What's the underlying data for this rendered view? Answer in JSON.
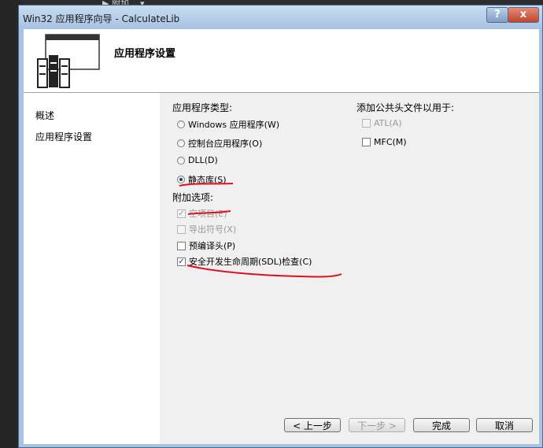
{
  "ide": {
    "run_label": "▶ 附加... ▾"
  },
  "window": {
    "title": "Win32 应用程序向导 - CalculateLib",
    "help_label": "?",
    "close_label": "x"
  },
  "header": {
    "title": "应用程序设置"
  },
  "nav": {
    "items": [
      {
        "label": "概述"
      },
      {
        "label": "应用程序设置"
      }
    ]
  },
  "app_type": {
    "heading": "应用程序类型:",
    "options": [
      {
        "label": "Windows 应用程序(W)",
        "selected": false
      },
      {
        "label": "控制台应用程序(O)",
        "selected": false
      },
      {
        "label": "DLL(D)",
        "selected": false
      },
      {
        "label": "静态库(S)",
        "selected": true
      }
    ]
  },
  "extra": {
    "heading": "附加选项:",
    "options": [
      {
        "label": "空项目(E)",
        "checked": true,
        "enabled": false
      },
      {
        "label": "导出符号(X)",
        "checked": false,
        "enabled": false
      },
      {
        "label": "预编译头(P)",
        "checked": false,
        "enabled": true
      },
      {
        "label": "安全开发生命周期(SDL)检查(C)",
        "checked": true,
        "enabled": true
      }
    ]
  },
  "common_headers": {
    "heading": "添加公共头文件以用于:",
    "options": [
      {
        "label": "ATL(A)",
        "checked": false,
        "enabled": false
      },
      {
        "label": "MFC(M)",
        "checked": false,
        "enabled": true
      }
    ]
  },
  "buttons": {
    "prev": "< 上一步",
    "next": "下一步 >",
    "finish": "完成",
    "cancel": "取消"
  },
  "colors": {
    "annotation": "#e0101a",
    "dialog_frame": "#a9c4e2"
  }
}
